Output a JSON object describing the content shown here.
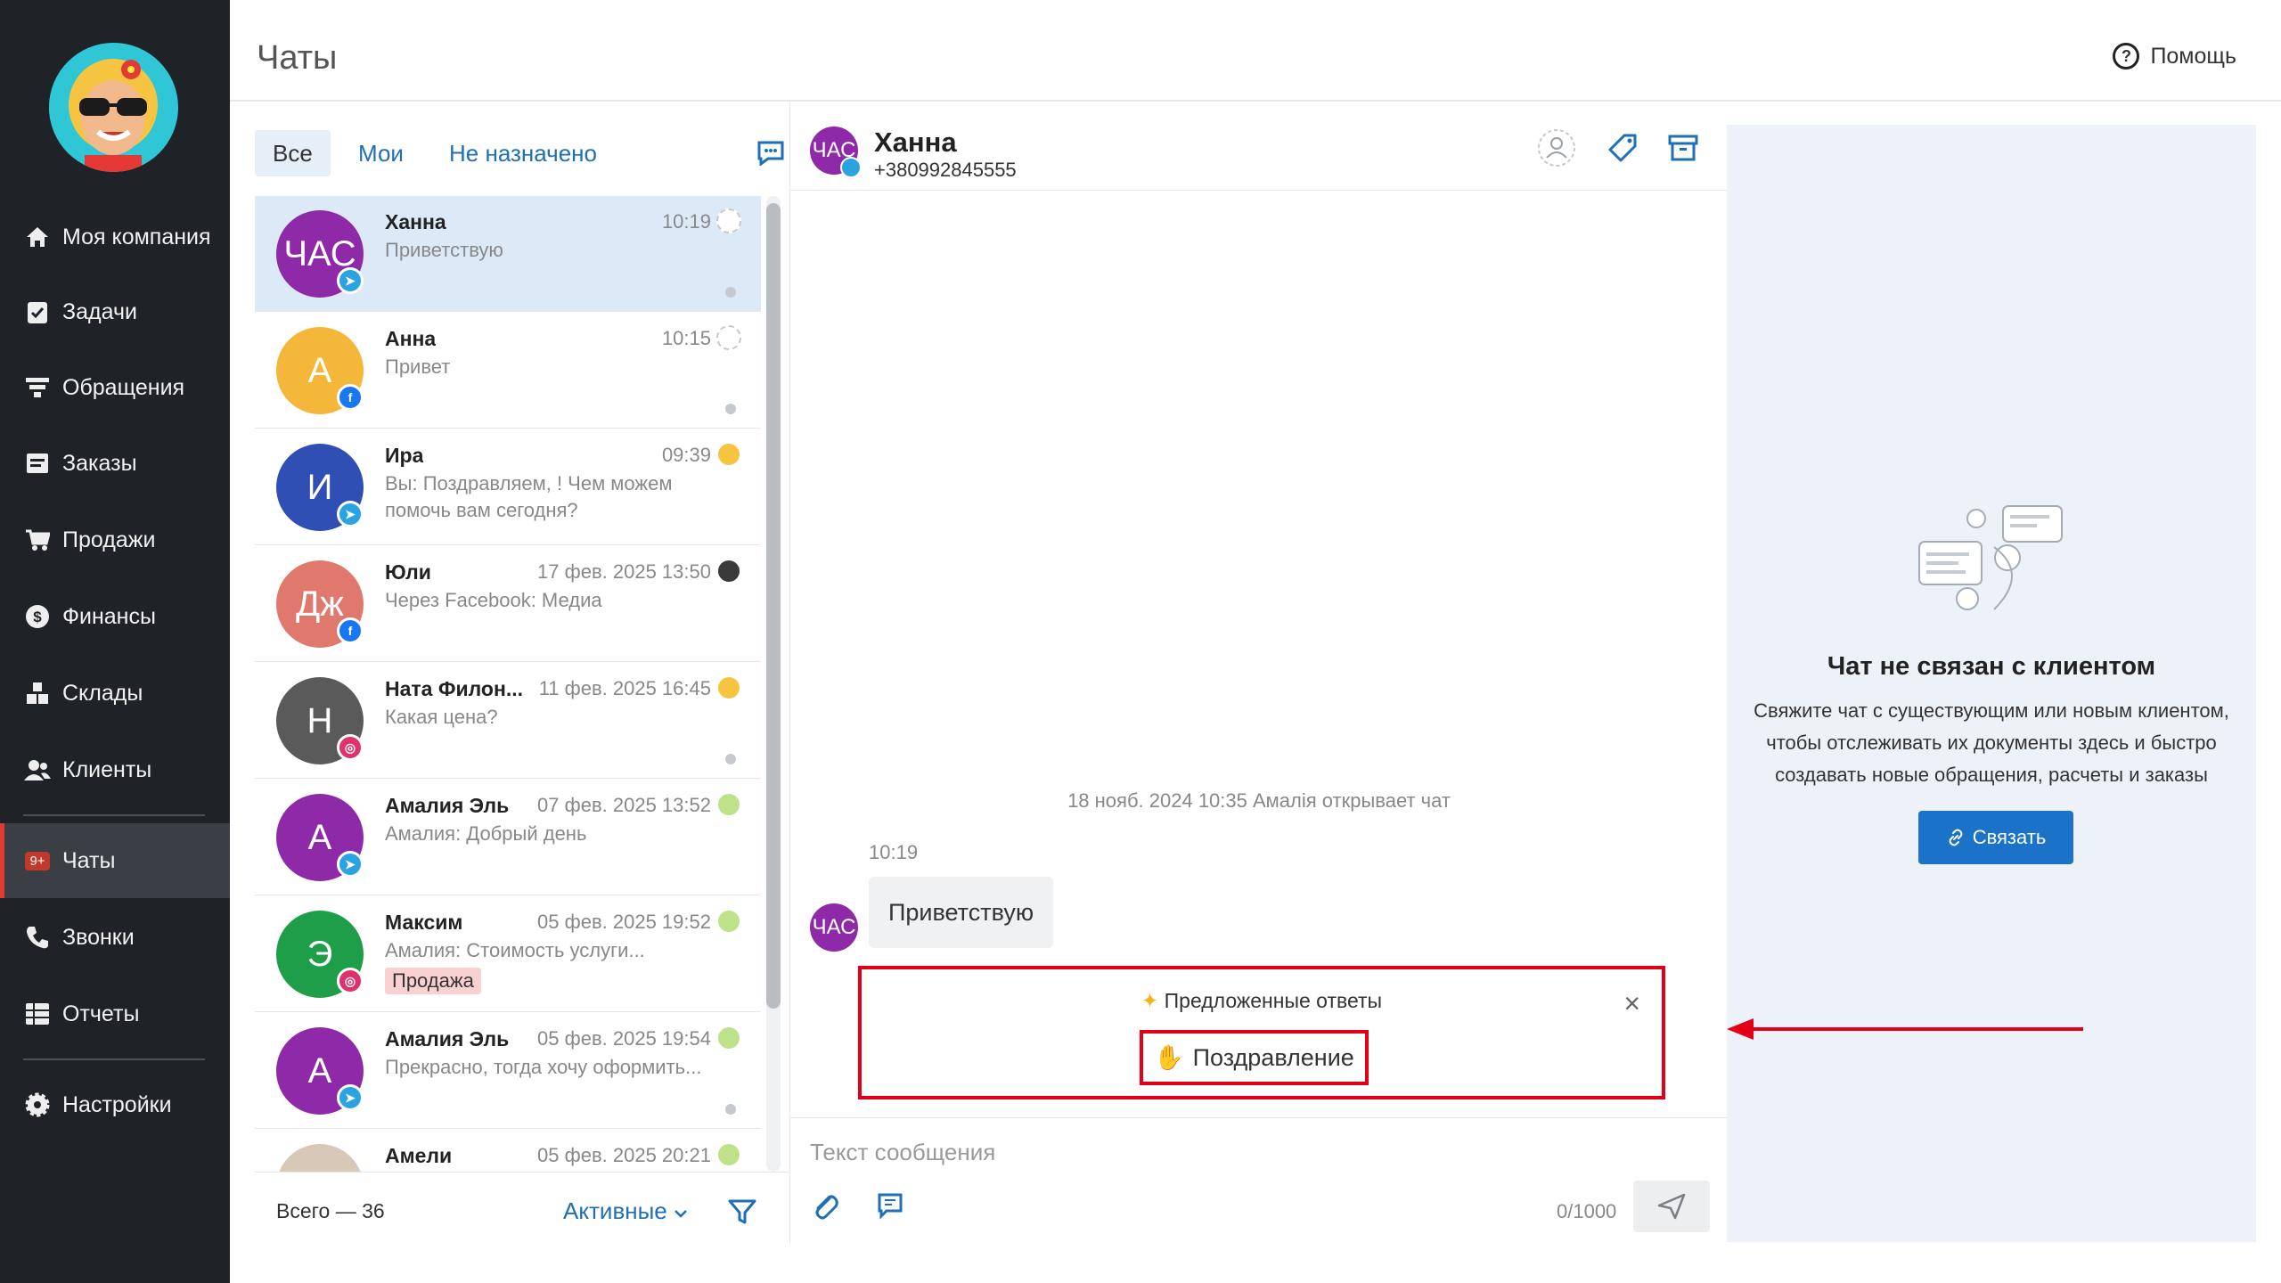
{
  "page_title": "Чаты",
  "help_label": "Помощь",
  "nav": [
    {
      "label": "Моя компания",
      "icon": "home-icon"
    },
    {
      "label": "Задачи",
      "icon": "checklist-icon"
    },
    {
      "label": "Обращения",
      "icon": "funnel-icon"
    },
    {
      "label": "Заказы",
      "icon": "orders-icon"
    },
    {
      "label": "Продажи",
      "icon": "cart-icon"
    },
    {
      "label": "Финансы",
      "icon": "coin-icon"
    },
    {
      "label": "Склады",
      "icon": "warehouse-icon"
    },
    {
      "label": "Клиенты",
      "icon": "users-icon"
    },
    {
      "label": "Чаты",
      "icon": "chat-icon",
      "badge": "9+",
      "active": true
    },
    {
      "label": "Звонки",
      "icon": "phone-icon"
    },
    {
      "label": "Отчеты",
      "icon": "reports-icon"
    },
    {
      "label": "Настройки",
      "icon": "gear-icon"
    }
  ],
  "filters": {
    "tabs": [
      {
        "label": "Все",
        "active": true
      },
      {
        "label": "Мои"
      },
      {
        "label": "Не назначено"
      }
    ]
  },
  "chats": [
    {
      "initials": "ЧАС",
      "name": "Ханна",
      "time": "10:19",
      "message": "Приветствую",
      "avatar_color": "#8e2aa8",
      "source": "telegram",
      "agent": "empty",
      "unread_dot": true,
      "selected": true
    },
    {
      "initials": "А",
      "name": "Анна",
      "time": "10:15",
      "message": "Привет",
      "avatar_color": "#f4b73a",
      "source": "facebook",
      "agent": "empty",
      "unread_dot": true
    },
    {
      "initials": "И",
      "name": "Ира",
      "time": "09:39",
      "message": "Вы: Поздравляем, ! Чем можем помочь вам сегодня?",
      "avatar_color": "#2f4fb5",
      "source": "telegram",
      "agent": "emoji"
    },
    {
      "initials": "Дж",
      "name": "Юли",
      "time": "17 фев. 2025 13:50",
      "message": "Через Facebook: Медиа",
      "avatar_color": "#e0786e",
      "source": "facebook",
      "agent": "dark"
    },
    {
      "initials": "Н",
      "name": "Ната Филон...",
      "time": "11 фев. 2025 16:45",
      "message": "Какая цена?",
      "avatar_color": "#5a5a5a",
      "source": "instagram",
      "agent": "emoji",
      "unread_dot": true
    },
    {
      "initials": "А",
      "name": "Амалия Эль",
      "time": "07 фев. 2025 13:52",
      "message": "Амалия: Добрый день",
      "avatar_color": "#8e2aa8",
      "source": "telegram",
      "agent": "emoji2"
    },
    {
      "initials": "Э",
      "name": "Максим",
      "time": "05 фев. 2025 19:52",
      "message": "Амалия: Стоимость услуги...",
      "avatar_color": "#1f9e4a",
      "source": "instagram",
      "agent": "emoji2",
      "tag": "Продажа"
    },
    {
      "initials": "А",
      "name": "Амалия Эль",
      "time": "05 фев. 2025 19:54",
      "message": "Прекрасно, тогда хочу оформить...",
      "avatar_color": "#8e2aa8",
      "source": "telegram",
      "agent": "emoji2",
      "unread_dot": true
    },
    {
      "initials": "",
      "name": "Амели",
      "time": "05 фев. 2025 20:21",
      "message": "",
      "avatar_color": "#d8c8b8",
      "source": "",
      "agent": "emoji2"
    }
  ],
  "list_footer": {
    "total": "Всего — 36",
    "status": "Активные"
  },
  "conversation": {
    "name": "Ханна",
    "initials": "ЧАС",
    "phone": "+380992845555",
    "system_note": "18 нояб. 2024 10:35 Амалія открывает чат",
    "message_time": "10:19",
    "message_text": "Приветствую",
    "suggestions_title": "Предложенные ответы",
    "suggestion": "Поздравление",
    "input_placeholder": "Текст сообщения",
    "counter": "0/1000"
  },
  "client_panel": {
    "title": "Чат не связан с клиентом",
    "description": "Свяжите чат с существующим или новым клиентом, чтобы отслеживать их документы здесь и быстро создавать новые обращения, расчеты и заказы",
    "button": "Связать"
  },
  "colors": {
    "sidebar": "#1f2328",
    "accent": "#1a73c9",
    "highlight": "#e30016",
    "telegram": "#2aa3e0",
    "facebook": "#1877f2",
    "instagram": "#e1306c"
  }
}
